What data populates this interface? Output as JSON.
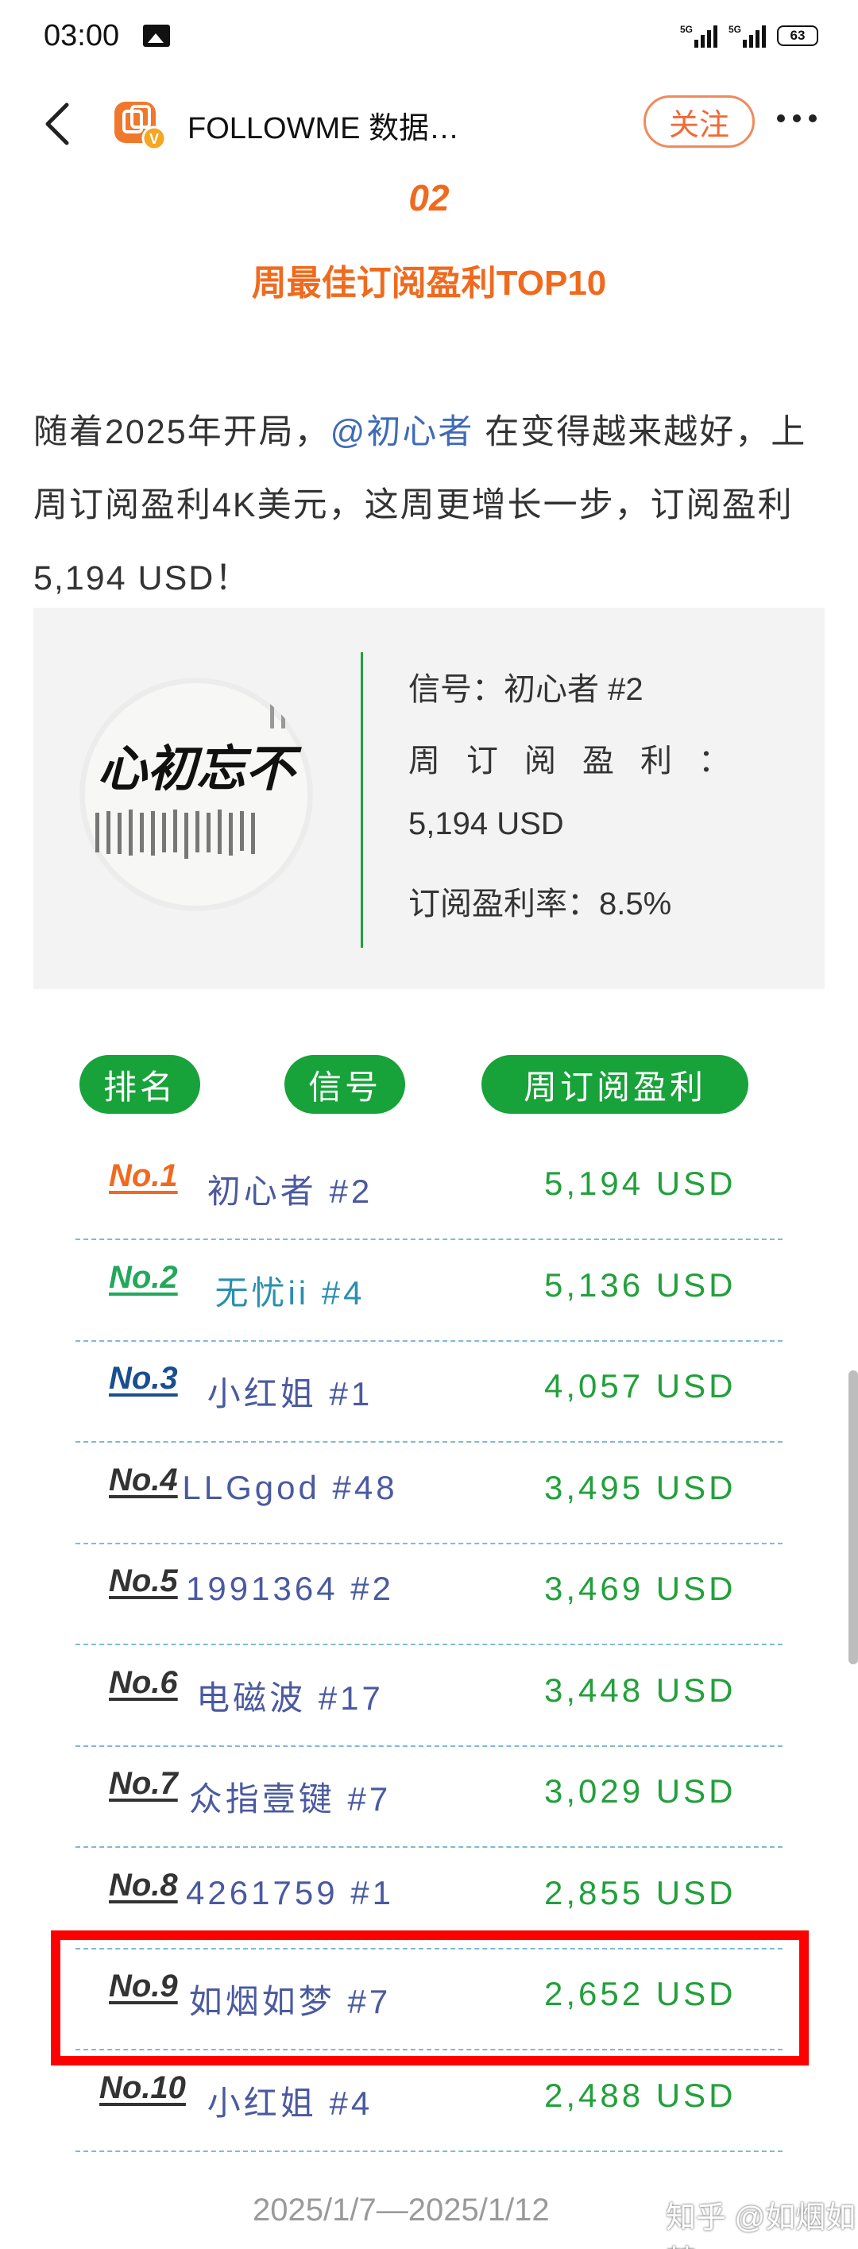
{
  "status_bar": {
    "time": "03:00",
    "signal_1": "5G",
    "signal_2": "5G",
    "battery": "63"
  },
  "header": {
    "title": "FOLLOWME 数据…",
    "follow_label": "关注",
    "logo_icon": "followme-logo-icon",
    "accent_color": "#f06a1e"
  },
  "section": {
    "number": "02",
    "title": "周最佳订阅盈利TOP10"
  },
  "paragraph": {
    "part1": "随着2025年开局，",
    "mention": "@初心者",
    "part2": " 在变得越来越好，上周订阅盈利4K美元，这周更增长一步，订阅盈利 5,194 USD！"
  },
  "info_card": {
    "signal_line": "信号：初心者 #2",
    "profit_label": "周订阅盈利：",
    "profit_value": "5,194 USD",
    "rate_line": "订阅盈利率：8.5%",
    "avatar_text": "不忘初心"
  },
  "table": {
    "headers": [
      "排名",
      "信号",
      "周订阅盈利"
    ],
    "header_color": "#18a23a",
    "rows": [
      {
        "rank": "No.1",
        "signal": "初心者 #2",
        "profit": "5,194 USD",
        "rank_color": "#f06a1e"
      },
      {
        "rank": "No.2",
        "signal": "无忧ii #4",
        "profit": "5,136 USD",
        "rank_color": "#22a85a"
      },
      {
        "rank": "No.3",
        "signal": "小红姐 #1",
        "profit": "4,057 USD",
        "rank_color": "#1a4f8f"
      },
      {
        "rank": "No.4",
        "signal": "LLGgod #48",
        "profit": "3,495 USD",
        "rank_color": "#333333"
      },
      {
        "rank": "No.5",
        "signal": "1991364 #2",
        "profit": "3,469 USD",
        "rank_color": "#333333"
      },
      {
        "rank": "No.6",
        "signal": "电磁波 #17",
        "profit": "3,448 USD",
        "rank_color": "#333333"
      },
      {
        "rank": "No.7",
        "signal": "众指壹键 #7",
        "profit": "3,029 USD",
        "rank_color": "#333333"
      },
      {
        "rank": "No.8",
        "signal": "4261759 #1",
        "profit": "2,855 USD",
        "rank_color": "#333333"
      },
      {
        "rank": "No.9",
        "signal": "如烟如梦 #7",
        "profit": "2,652 USD",
        "rank_color": "#333333"
      },
      {
        "rank": "No.10",
        "signal": "小红姐 #4",
        "profit": "2,488 USD",
        "rank_color": "#333333"
      }
    ]
  },
  "footer": {
    "date_range": "2025/1/7—2025/1/12",
    "watermark": "知乎 @如烟如梦"
  }
}
